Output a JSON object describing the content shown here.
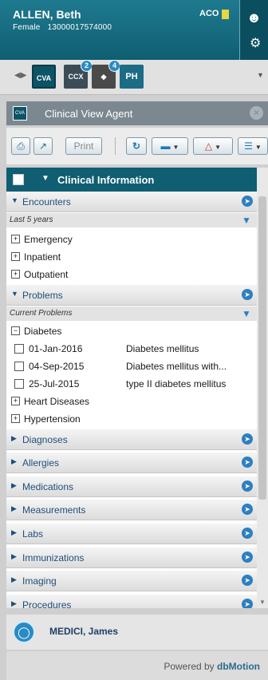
{
  "patient": {
    "name": "ALLEN, Beth",
    "gender": "Female",
    "id": "13000017574000",
    "aco": "ACO"
  },
  "agents": [
    {
      "name": "cva-agent",
      "label": "CVA"
    },
    {
      "name": "ccx-agent",
      "label": "CCX",
      "badge": "2"
    },
    {
      "name": "rx-agent",
      "label": "",
      "badge": "4"
    },
    {
      "name": "ph-agent",
      "label": "PH"
    }
  ],
  "panel": {
    "title": "Clinical View Agent"
  },
  "toolbar": {
    "print_label": "Print"
  },
  "clinical": {
    "title": "Clinical Information",
    "encounters": {
      "label": "Encounters",
      "range": "Last 5 years",
      "items": [
        "Emergency",
        "Inpatient",
        "Outpatient"
      ]
    },
    "problems": {
      "label": "Problems",
      "subheader": "Current Problems",
      "group": "Diabetes",
      "entries": [
        {
          "date": "01-Jan-2016",
          "desc": "Diabetes mellitus"
        },
        {
          "date": "04-Sep-2015",
          "desc": "Diabetes mellitus with..."
        },
        {
          "date": "25-Jul-2015",
          "desc": "type II diabetes mellitus"
        }
      ],
      "groups": [
        "Heart Diseases",
        "Hypertension"
      ]
    },
    "sections": [
      "Diagnoses",
      "Allergies",
      "Medications",
      "Measurements",
      "Labs",
      "Immunizations",
      "Imaging",
      "Procedures"
    ]
  },
  "footer": {
    "user": "MEDICI, James",
    "powered_prefix": "Powered by ",
    "powered_brand": "dbMotion"
  },
  "colors": {
    "header": "#0f5e72",
    "accent": "#2d7fc0"
  }
}
